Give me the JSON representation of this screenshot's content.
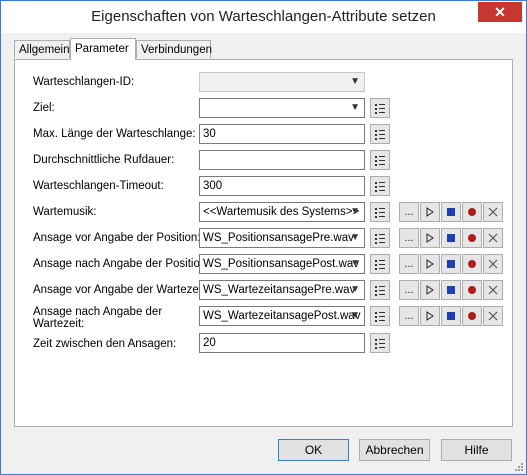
{
  "window": {
    "title": "Eigenschaften von Warteschlangen-Attribute setzen",
    "close_glyph": "✕"
  },
  "tabs": [
    {
      "label": "Allgemein",
      "active": false
    },
    {
      "label": "Parameter",
      "active": true
    },
    {
      "label": "Verbindungen",
      "active": false
    }
  ],
  "fields": {
    "queue_id": {
      "label": "Warteschlangen-ID:",
      "value": ""
    },
    "ziel": {
      "label": "Ziel:",
      "value": ""
    },
    "max_length": {
      "label": "Max. Länge der Warteschlange:",
      "value": "30"
    },
    "avg_duration": {
      "label": "Durchschnittliche Rufdauer:",
      "value": ""
    },
    "timeout": {
      "label": "Warteschlangen-Timeout:",
      "value": "300"
    },
    "music": {
      "label": "Wartemusik:",
      "value": "<<Wartemusik des Systems>>"
    },
    "ann_pos_before": {
      "label": "Ansage vor Angabe der Position:",
      "value": "WS_PositionsansagePre.wav"
    },
    "ann_pos_after": {
      "label": "Ansage nach Angabe der Position:",
      "value": "WS_PositionsansagePost.wav"
    },
    "ann_wait_before": {
      "label": "Ansage vor Angabe der Wartezeit:",
      "value": "WS_WartezeitansagePre.wav"
    },
    "ann_wait_after": {
      "label_line1": "Ansage nach Angabe der",
      "label_line2": "Wartezeit:",
      "value": "WS_WartezeitansagePost.wav"
    },
    "interval": {
      "label": "Zeit zwischen den Ansagen:",
      "value": "20"
    }
  },
  "buttons": {
    "ok": "OK",
    "cancel": "Abbrechen",
    "help": "Hilfe",
    "browse": "..."
  },
  "icons": {
    "list": "list-icon",
    "play": "play-icon",
    "stop": "stop-icon",
    "record": "record-icon",
    "delete": "delete-icon"
  },
  "colors": {
    "stop": "#1f3fb5",
    "record": "#b01d1d",
    "accent": "#3c7fb1"
  }
}
